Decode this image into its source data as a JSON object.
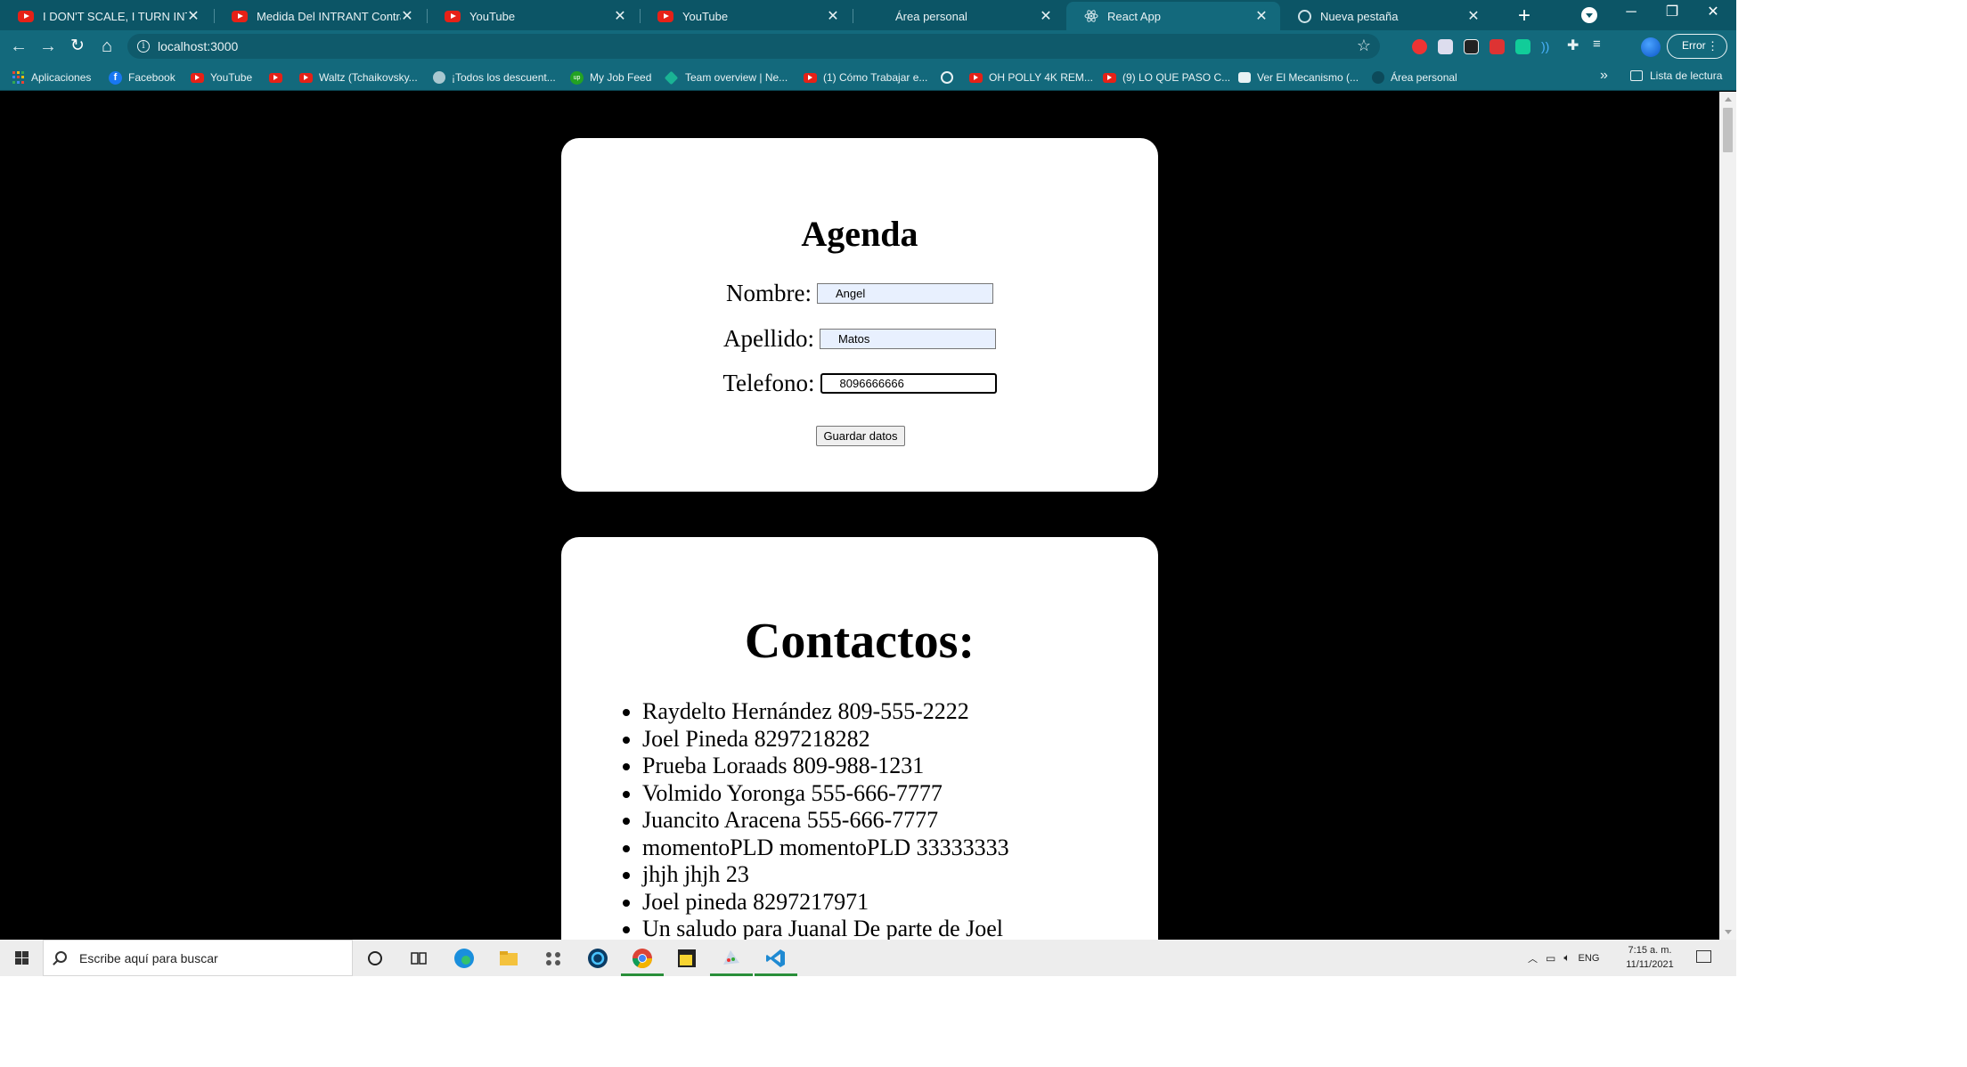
{
  "browser": {
    "tabs": [
      {
        "title": "I DON'T SCALE, I TURN INTO A G",
        "icon": "youtube-icon",
        "active": false
      },
      {
        "title": "Medida Del INTRANT Contra UB",
        "icon": "youtube-icon",
        "active": false
      },
      {
        "title": "YouTube",
        "icon": "youtube-icon",
        "active": false
      },
      {
        "title": "YouTube",
        "icon": "youtube-icon",
        "active": false
      },
      {
        "title": "Área personal",
        "icon": "blank-icon",
        "active": false
      },
      {
        "title": "React App",
        "icon": "react-icon",
        "active": true
      },
      {
        "title": "Nueva pestaña",
        "icon": "globe-icon",
        "active": false
      }
    ],
    "url": "localhost:3000",
    "error_label": "Error",
    "bookmarks": [
      {
        "label": "Aplicaciones",
        "icon": "apps-grid-icon"
      },
      {
        "label": "Facebook",
        "icon": "facebook-icon"
      },
      {
        "label": "YouTube",
        "icon": "youtube-icon"
      },
      {
        "label": "",
        "icon": "youtube-icon"
      },
      {
        "label": "Waltz (Tchaikovsky...",
        "icon": "youtube-icon"
      },
      {
        "label": "¡Todos los descuent...",
        "icon": "site-icon"
      },
      {
        "label": "My Job Feed",
        "icon": "upwork-icon"
      },
      {
        "label": "Team overview | Ne...",
        "icon": "diamond-icon"
      },
      {
        "label": "(1) Cómo Trabajar e...",
        "icon": "youtube-icon"
      },
      {
        "label": "",
        "icon": "globe-icon"
      },
      {
        "label": "OH POLLY 4K REM...",
        "icon": "youtube-icon"
      },
      {
        "label": "(9) LO QUE PASO C...",
        "icon": "youtube-icon"
      },
      {
        "label": "Ver El Mecanismo (...",
        "icon": "film-icon"
      },
      {
        "label": "Área personal",
        "icon": "dark-site-icon"
      }
    ],
    "reading_list": "Lista de lectura"
  },
  "page": {
    "agenda": {
      "title": "Agenda",
      "fields": [
        {
          "label": "Nombre:",
          "value": "Angel"
        },
        {
          "label": "Apellido:",
          "value": "Matos"
        },
        {
          "label": "Telefono:",
          "value": "8096666666"
        }
      ],
      "save_label": "Guardar datos"
    },
    "contacts": {
      "title": "Contactos:",
      "items": [
        "Raydelto Hernández 809-555-2222",
        "Joel Pineda 8297218282",
        "Prueba Loraads 809-988-1231",
        "Volmido Yoronga 555-666-7777",
        "Juancito Aracena 555-666-7777",
        "momentoPLD momentoPLD 33333333",
        "jhjh jhjh 23",
        "Joel pineda 8297217971",
        "Un saludo para Juanal De parte de Joel"
      ]
    }
  },
  "taskbar": {
    "search_placeholder": "Escribe aquí para buscar",
    "tray_lang": "ENG",
    "time": "7:15 a. m.",
    "date": "11/11/2021"
  },
  "colors": {
    "chrome_frame": "#0c5566",
    "chrome_toolbar": "#13697c",
    "page_bg": "#000000",
    "card_bg": "#ffffff"
  }
}
